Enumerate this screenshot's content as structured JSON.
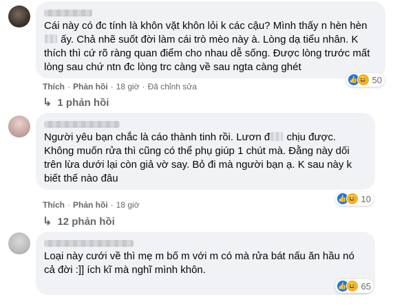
{
  "comments": [
    {
      "text_before": "Cái này có đc tính là khôn vặt khôn lỏi k các cậu? Mình thấy n hèn hèn ",
      "text_after": " ấy. Chả nhẽ suốt đời làm cái trò mèo này à. Lòng dạ tiểu nhân. K thích thì cứ rõ ràng quan điểm cho nhau dễ sống. Được lòng trước mất lòng sau chứ ntn đc lòng trc càng về sau ngta càng ghét",
      "reaction_count": "50",
      "like_label": "Thích",
      "reply_label": "Phản hồi",
      "time": "18 giờ",
      "edited": "Đã chỉnh sửa",
      "replies_label": "1 phản hồi",
      "reaction_icons": [
        "like-icon",
        "haha-icon"
      ]
    },
    {
      "text_before": "Người yêu bạn chắc là cáo thành tinh rồi. Lươn đ",
      "text_after": " chịu được. Không muốn rửa thì cũng có thể phụ giúp 1 chút mà. Đằng này dối trên lừa dưới lại còn giả vờ say. Bỏ đi mà người bạn ạ. K sau này k biết thế nào đâu",
      "reaction_count": "10",
      "like_label": "Thích",
      "reply_label": "Phản hồi",
      "time": "18 giờ",
      "replies_label": "12 phản hồi",
      "reaction_icons": [
        "like-icon",
        "haha-icon"
      ]
    },
    {
      "text": "Loại này cưới về thì mẹ m bố m với m có mà rửa bát nấu ăn hầu nó cả đời :]] ích kĩ mà nghĩ mình khôn.",
      "reaction_count": "65",
      "reaction_icons": [
        "like-icon",
        "haha-icon"
      ]
    }
  ],
  "colors": {
    "bubble": "#f0f2f5",
    "meta_text": "#65676b",
    "like_blue": "#1877f2",
    "haha_yellow": "#f7b125"
  }
}
